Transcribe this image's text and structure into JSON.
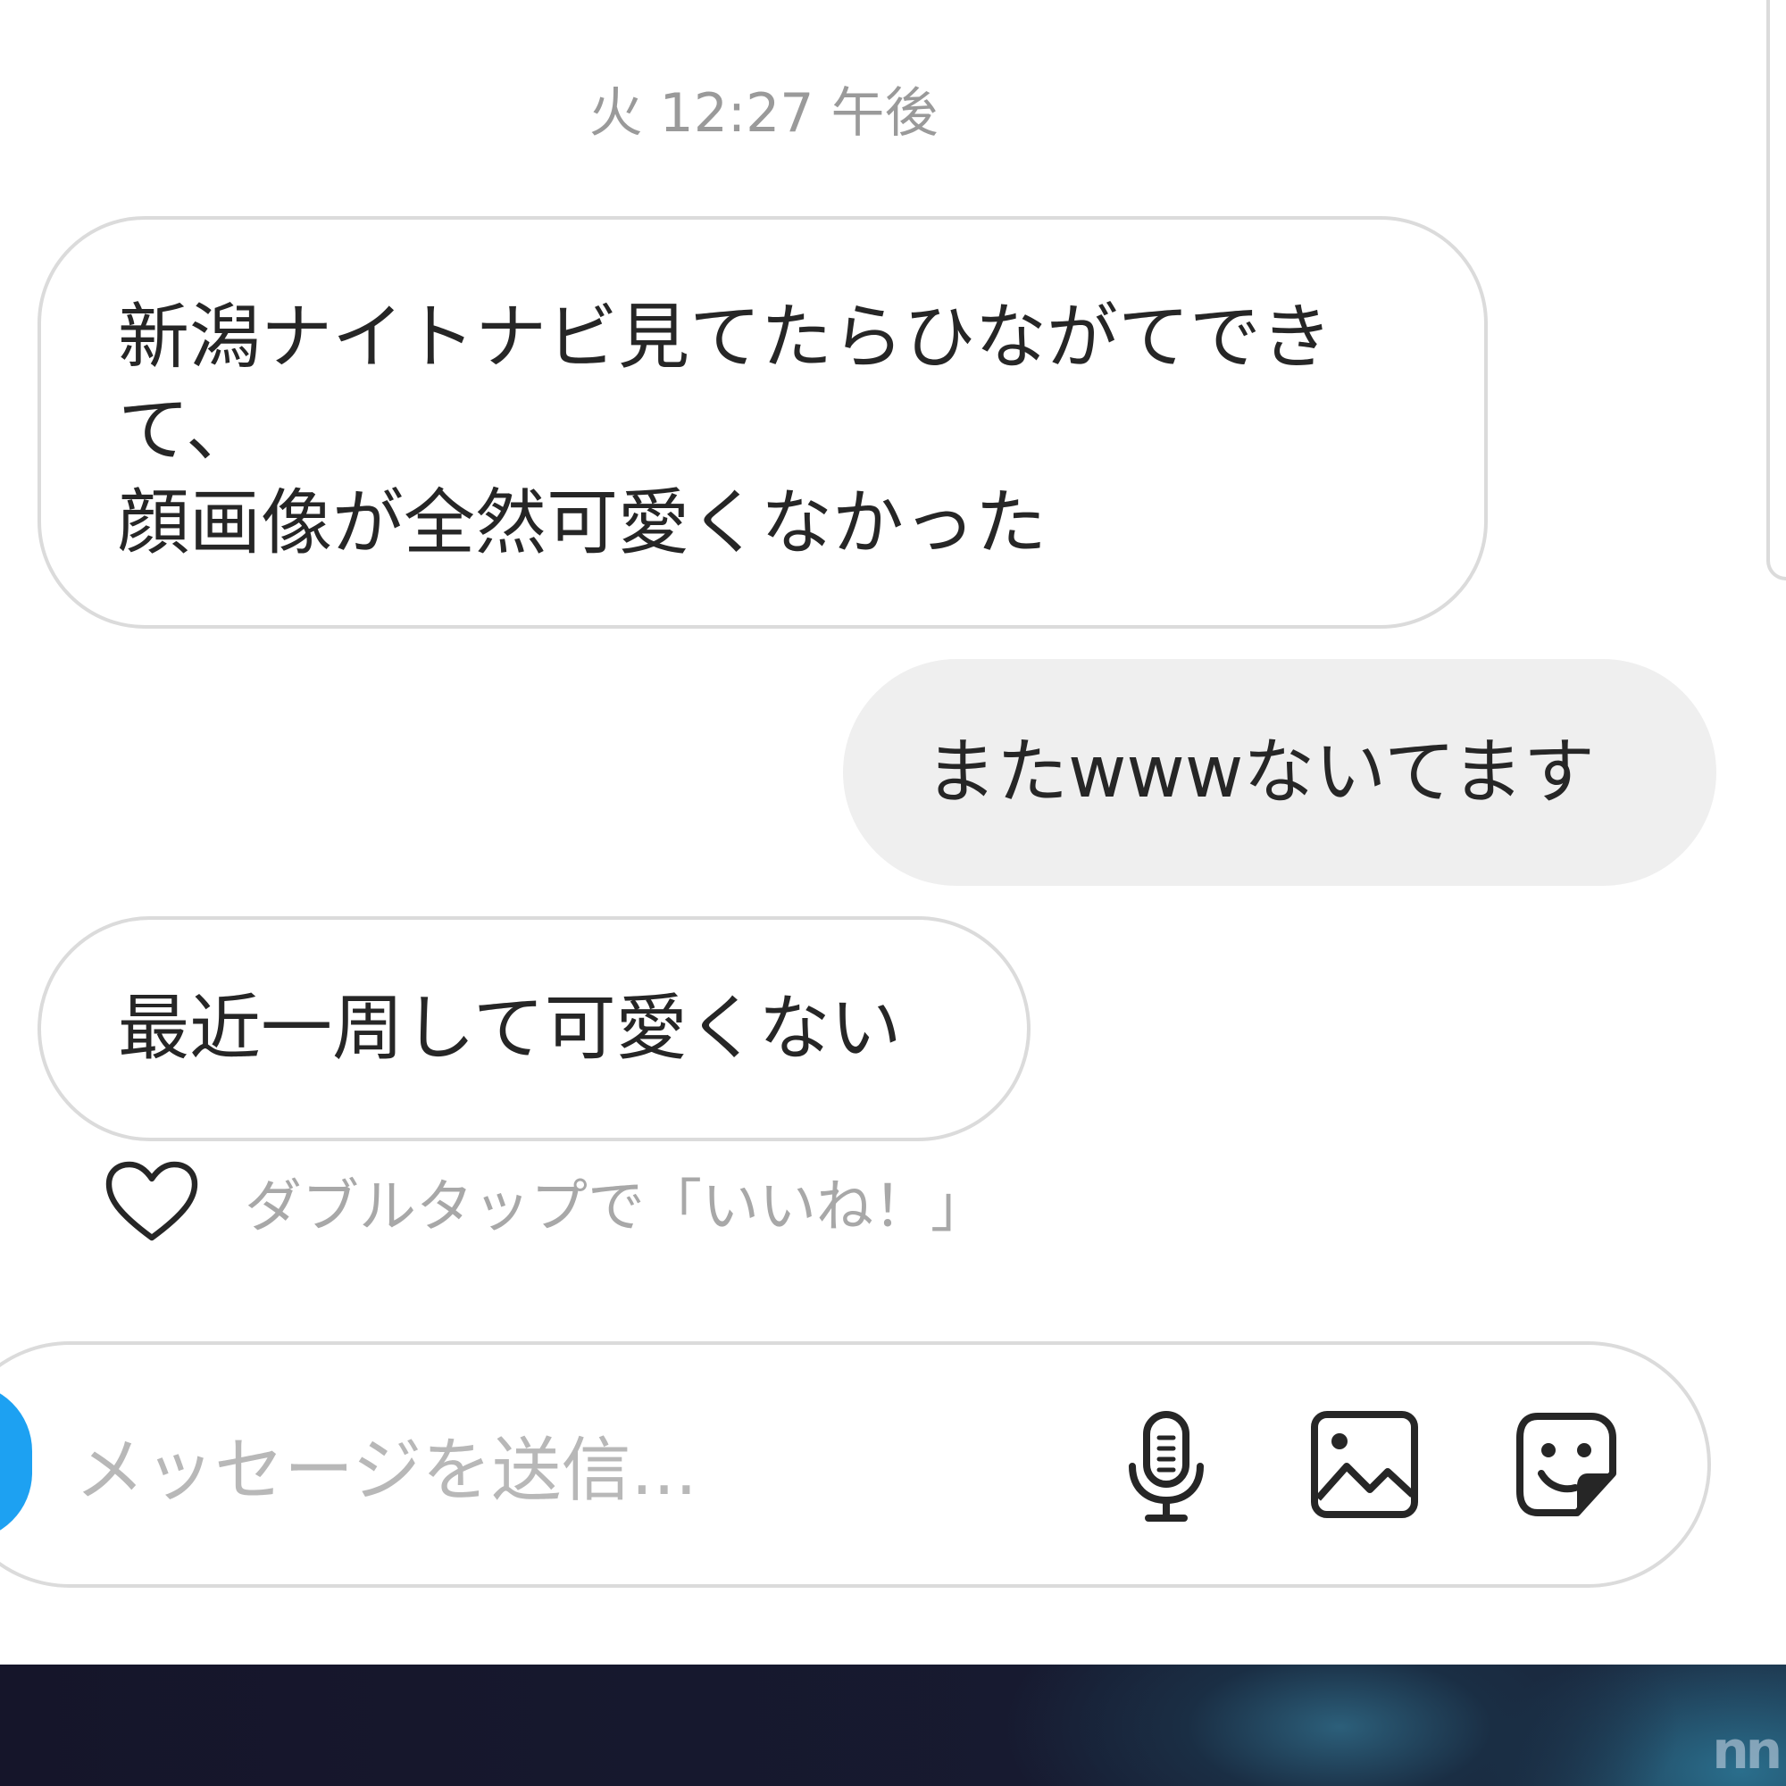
{
  "timestamp": "火 12:27 午後",
  "messages": [
    {
      "side": "received",
      "lines": [
        "新潟ナイトナビ見てたらひながてでき",
        "て、",
        "顔画像が全然可愛くなかった"
      ]
    },
    {
      "side": "sent",
      "lines": [
        "またwwwないてます"
      ]
    },
    {
      "side": "received",
      "lines": [
        "最近一周して可愛くない"
      ]
    }
  ],
  "like_hint": {
    "text": "ダブルタップで「いいね！」",
    "icon": "heart-outline-icon"
  },
  "composer": {
    "placeholder": "メッセージを送信...",
    "icons": [
      "microphone-icon",
      "image-gallery-icon",
      "sticker-icon"
    ]
  },
  "watermark": "nn",
  "colors": {
    "accent": "#1da1f2",
    "bubble_border": "#dbdbdb",
    "sent_bubble": "#efefef",
    "meta_text": "#9a9a9a"
  }
}
